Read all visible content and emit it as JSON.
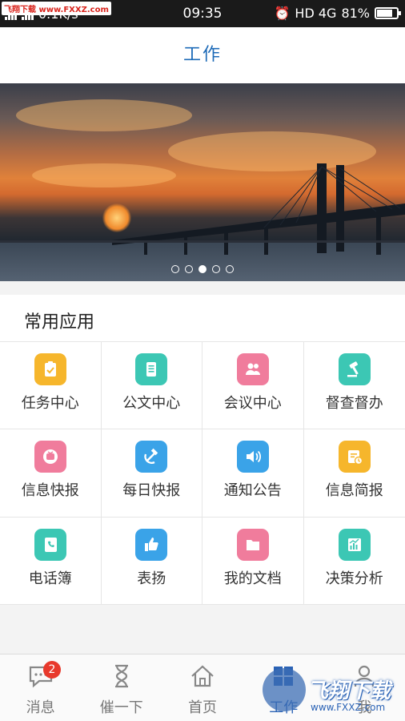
{
  "status_bar": {
    "watermark": "飞翔下载 www.FXXZ.com",
    "speed": "0.1K/s",
    "time": "09:35",
    "network": "HD 4G",
    "battery": "81%",
    "battery_level": 0.81
  },
  "header": {
    "title": "工作"
  },
  "banner": {
    "slides": 5,
    "active_index": 2
  },
  "section": {
    "title": "常用应用"
  },
  "apps": [
    {
      "label": "任务中心",
      "icon": "clipboard-check-icon",
      "color": "#f6b62c"
    },
    {
      "label": "公文中心",
      "icon": "document-icon",
      "color": "#3cc7b4"
    },
    {
      "label": "会议中心",
      "icon": "people-icon",
      "color": "#f07c9c"
    },
    {
      "label": "督查督办",
      "icon": "gavel-icon",
      "color": "#3cc7b4"
    },
    {
      "label": "信息快报",
      "icon": "tv-icon",
      "color": "#f07c9c"
    },
    {
      "label": "每日快报",
      "icon": "hammer-sickle-icon",
      "color": "#3aa3e8"
    },
    {
      "label": "通知公告",
      "icon": "speaker-icon",
      "color": "#3aa3e8"
    },
    {
      "label": "信息简报",
      "icon": "report-clock-icon",
      "color": "#f6b62c"
    },
    {
      "label": "电话簿",
      "icon": "phone-book-icon",
      "color": "#3cc7b4"
    },
    {
      "label": "表扬",
      "icon": "thumbs-up-icon",
      "color": "#3aa3e8"
    },
    {
      "label": "我的文档",
      "icon": "folder-icon",
      "color": "#f07c9c"
    },
    {
      "label": "决策分析",
      "icon": "chart-icon",
      "color": "#3cc7b4"
    }
  ],
  "tabbar": {
    "items": [
      {
        "label": "消息",
        "icon": "chat-icon"
      },
      {
        "label": "催一下",
        "icon": "hourglass-icon"
      },
      {
        "label": "首页",
        "icon": "home-icon"
      },
      {
        "label": "工作",
        "icon": "grid-icon"
      },
      {
        "label": "我",
        "icon": "person-icon"
      }
    ],
    "message_badge": "2",
    "active": "工作"
  },
  "watermark_bottom": {
    "title": "飞翔下载",
    "url": "www.FXXZ.com"
  }
}
